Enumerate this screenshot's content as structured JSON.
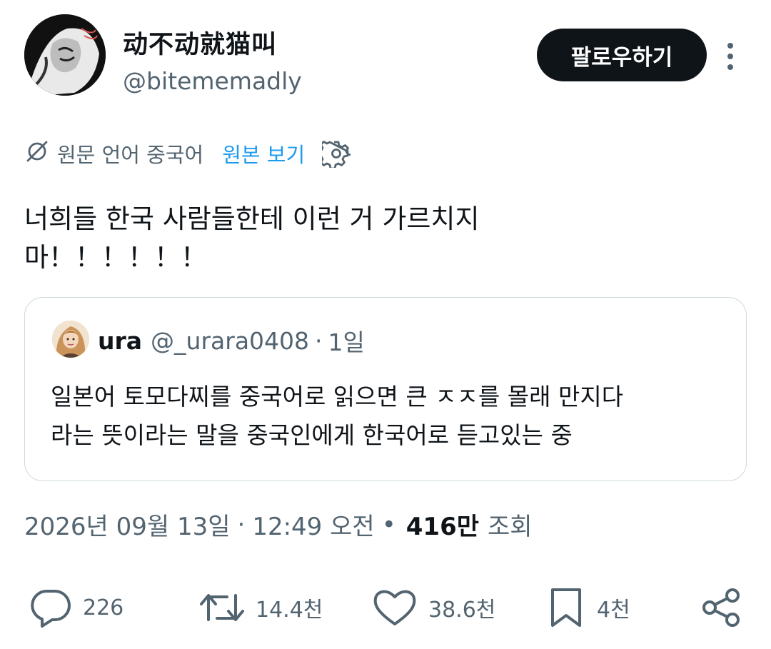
{
  "author": {
    "display_name": "动不动就猫叫",
    "handle": "@bitememadly",
    "follow_label": "팔로우하기"
  },
  "translation": {
    "source_label": "원문 언어 중국어",
    "show_original_label": "원본 보기"
  },
  "tweet": {
    "text_lines": [
      "너희들 한국 사람들한테 이런 거 가르치지",
      "마！！！！！！"
    ]
  },
  "quoted_tweet": {
    "name": "ura",
    "handle": "@_urara0408",
    "dot": "·",
    "time": "1일",
    "text_lines": [
      "일본어 토모다찌를 중국어로 읽으면 큰 ㅈㅈ를 몰래 만지다",
      "라는 뜻이라는 말을 중국인에게 한국어로 듣고있는 중"
    ]
  },
  "meta": {
    "date": "2026년 09월 13일",
    "sep": "·",
    "time": "12:49 오전",
    "dot": "•",
    "views_count": "416만",
    "views_label": "조회"
  },
  "actions": {
    "replies": "226",
    "retweets": "14.4천",
    "likes": "38.6천",
    "bookmarks": "4천"
  },
  "icons": {
    "avatar": "illustrated-character-avatar",
    "more": "more-vertical-icon",
    "translate": "translate-globe-slash-icon",
    "settings": "gear-icon",
    "reply": "reply-bubble-icon",
    "retweet": "retweet-icon",
    "like": "heart-icon",
    "bookmark": "bookmark-icon",
    "share": "share-icon"
  },
  "colors": {
    "text": "#0f1419",
    "secondary": "#536471",
    "link": "#1d9bf0",
    "border": "#cfd9de"
  }
}
